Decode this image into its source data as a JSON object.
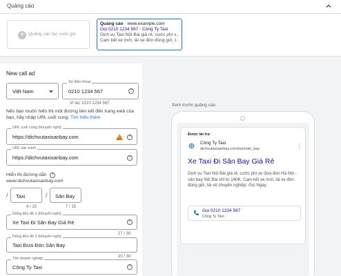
{
  "header": {
    "title": "Quảng cáo"
  },
  "ad_list": {
    "create_label": "Quảng cáo tạo cuộc gọi",
    "card": {
      "ad_prefix": "Quảng cáo",
      "domain": " · www.example.com",
      "line2": "Gọi 0210 1234 567 - Công Ty Taxi",
      "line3": "Dịch vụ Taxi Nội Bài giá rẻ, cước phí x...",
      "line4": "Cam kết xe mới, lái xe đón đúng giờ, t..."
    }
  },
  "form": {
    "title": "New call ad",
    "country": "Việt Nam",
    "phone_label": "Số điện thoại",
    "phone_value": "0210 1234 567",
    "phone_example": "Ví dụ: 0210 1234 567",
    "info_text": "Nếu bạn muốn hiển thị một đường liên kết đến trang web của bạn, hãy nhập URL cuối cùng.",
    "info_link": "Tìm hiểu thêm",
    "final_url_label": "URL cuối cùng (khuyến nghị)",
    "final_url_value": "https://dichvutaxisanbay.com",
    "verify_url_label": "URL xác minh",
    "verify_url_value": "https://dichvutaxisanbay.com",
    "display_path_label": "Hiển thị đường dẫn",
    "display_domain": "www.dichvutaxisanbay.com",
    "path1_value": "Taxi",
    "path1_count": "4 / 15",
    "path2_value": "Sân Bay",
    "path2_count": "7 / 15",
    "headline1_label": "Dòng tiêu đề 1 (khuyến nghị)",
    "headline1_value": "Xe Taxi Đi Sân Bay Giá Rẻ",
    "headline1_count": "27 / 30",
    "headline2_label": "Dòng tiêu đề 2 (khuyến nghị)",
    "headline2_value": "Taxi Đưa Đón Sân Bay",
    "headline2_count": "20 / 30",
    "business_label": "Tên doanh nghiệp",
    "business_value": "Công Ty Taxi"
  },
  "preview": {
    "label": "Xem trước quảng cáo",
    "sponsored": "Được tài trợ",
    "business": "Công Ty Taxi",
    "url": "dichvutaxisanbay.com/taxi/sân_bay",
    "headline": "Xe Taxi Đi Sân Bay Giá Rẻ",
    "description": "Dịch vụ Taxi Nội Bài giá rẻ, cước phí xe đưa đón Hà Nội - sân bay Nội Bài chỉ từ 160K. Cam kết xe mới, lái xe đón đúng giờ, tài xế chuyên nghiệp. Gọi Ngay",
    "call_number": "Gọi 0210 1234 567",
    "call_business": "Công Ty Taxi"
  },
  "colors": {
    "accent": "#1a73e8",
    "link": "#1a0dab",
    "warning": "#e37400"
  }
}
